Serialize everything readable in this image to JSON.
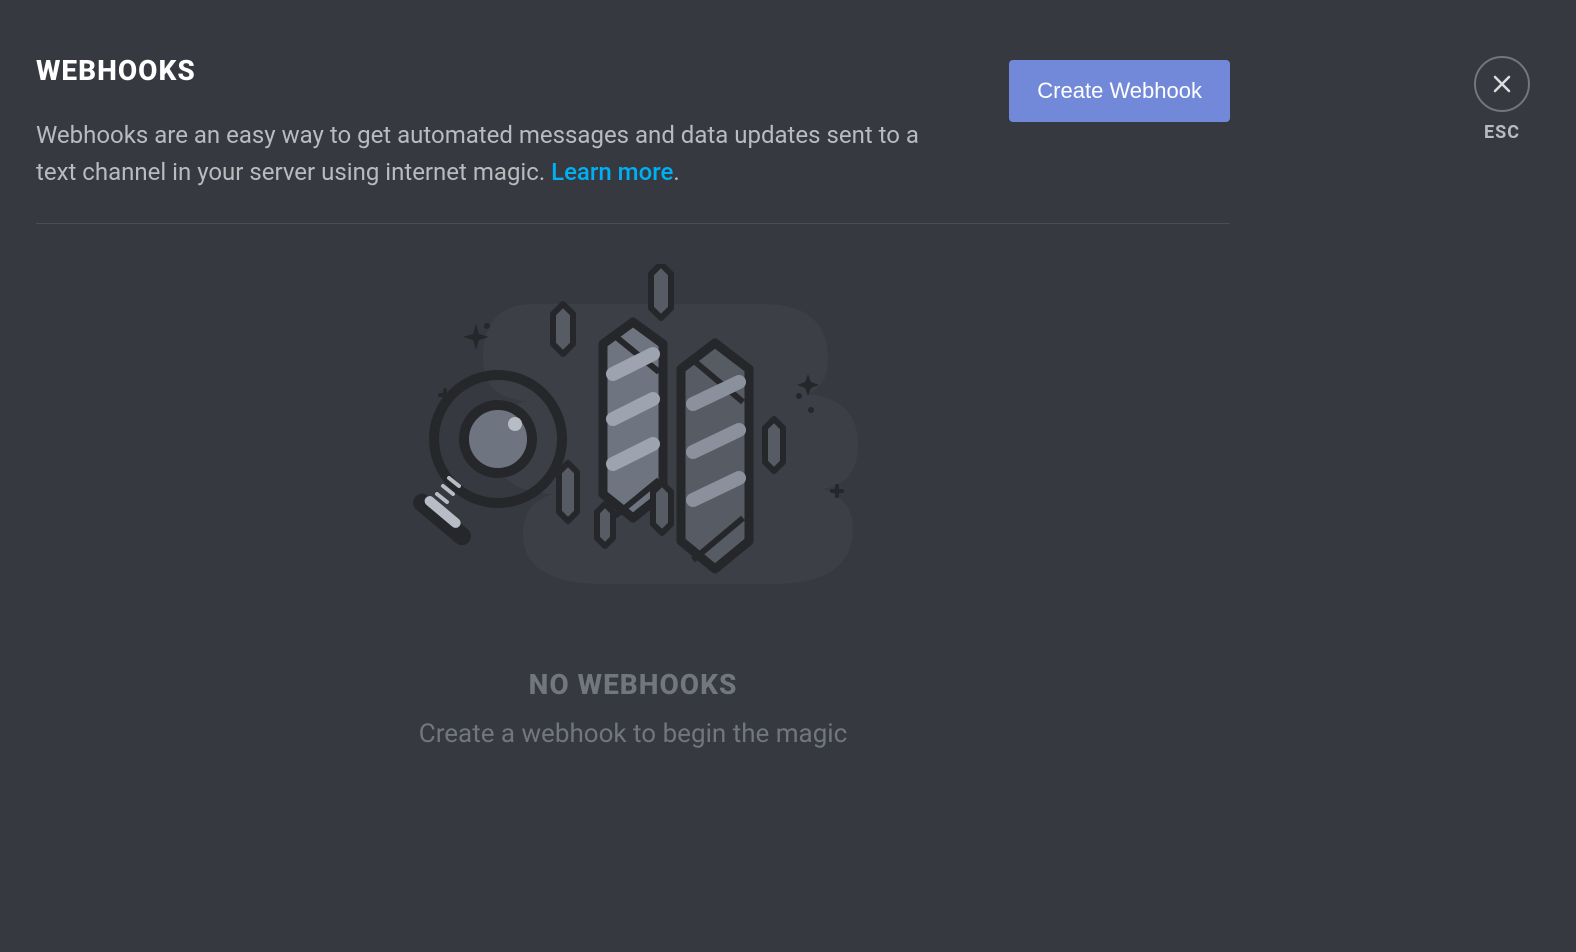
{
  "page": {
    "title": "WEBHOOKS",
    "description_prefix": "Webhooks are an easy way to get automated messages and data updates sent to a text channel in your server using internet magic. ",
    "learn_more": "Learn more",
    "description_suffix": ".",
    "create_button": "Create Webhook"
  },
  "close": {
    "esc_label": "ESC"
  },
  "empty": {
    "title": "NO WEBHOOKS",
    "subtitle": "Create a webhook to begin the magic"
  },
  "colors": {
    "bg": "#36393f",
    "accent": "#7289da",
    "link": "#00b0f4",
    "text_muted": "#b9bbbe",
    "text_faint": "#72767d"
  }
}
